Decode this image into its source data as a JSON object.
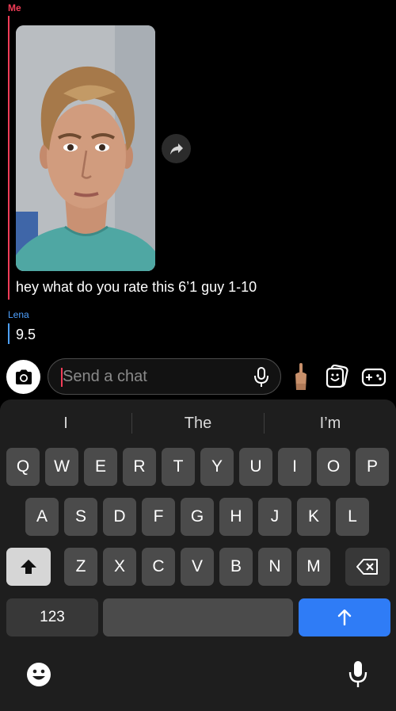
{
  "chat": {
    "me_label": "Me",
    "me_message": "hey what do you rate this 6’1 guy 1-10",
    "lena_label": "Lena",
    "lena_message": "9.5"
  },
  "input": {
    "placeholder": "Send a chat"
  },
  "keyboard": {
    "suggestions": [
      "I",
      "The",
      "I’m"
    ],
    "row1": [
      "Q",
      "W",
      "E",
      "R",
      "T",
      "Y",
      "U",
      "I",
      "O",
      "P"
    ],
    "row2": [
      "A",
      "S",
      "D",
      "F",
      "G",
      "H",
      "J",
      "K",
      "L"
    ],
    "row3": [
      "Z",
      "X",
      "C",
      "V",
      "B",
      "N",
      "M"
    ],
    "numbers_label": "123"
  },
  "icons": {
    "share": "share-arrow-icon",
    "camera": "camera-icon",
    "mic": "microphone-icon",
    "bitmoji": "bitmoji-icon",
    "sticker": "sticker-icon",
    "games": "game-controller-icon",
    "shift": "shift-arrow-icon",
    "delete": "backspace-icon",
    "return": "return-arrow-icon",
    "emoji": "emoji-icon",
    "dictation": "dictation-mic-icon"
  },
  "colors": {
    "me_accent": "#f23c57",
    "lena_accent": "#4ea1ff",
    "return_key": "#2f7cf6"
  }
}
